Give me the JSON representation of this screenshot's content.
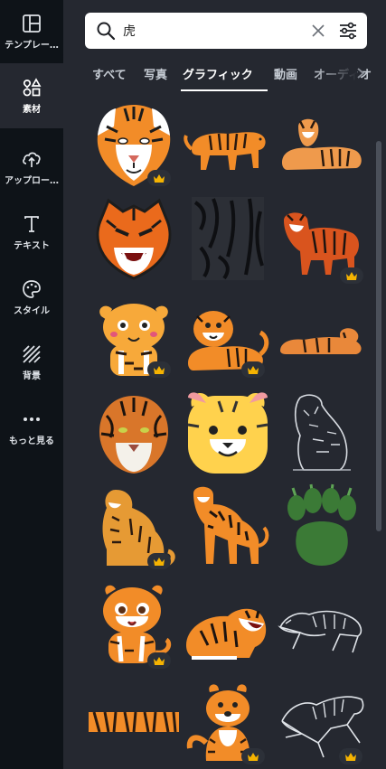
{
  "sidebar": {
    "items": [
      {
        "label": "テンプレー…",
        "icon": "template-icon"
      },
      {
        "label": "素材",
        "icon": "elements-icon"
      },
      {
        "label": "アップロー…",
        "icon": "upload-icon"
      },
      {
        "label": "テキスト",
        "icon": "text-icon"
      },
      {
        "label": "スタイル",
        "icon": "palette-icon"
      },
      {
        "label": "背景",
        "icon": "background-icon"
      },
      {
        "label": "もっと見る",
        "icon": "more-icon"
      }
    ]
  },
  "search": {
    "value": "虎",
    "placeholder": ""
  },
  "tabs": [
    {
      "label": "すべて"
    },
    {
      "label": "写真"
    },
    {
      "label": "グラフィック"
    },
    {
      "label": "動画"
    },
    {
      "label": "オーディオ"
    }
  ],
  "active_tab": "グラフィック",
  "results": [
    {
      "name": "tiger-face-illustration",
      "premium": true
    },
    {
      "name": "walking-tiger",
      "premium": false
    },
    {
      "name": "lying-tiger",
      "premium": false
    },
    {
      "name": "roaring-tiger-mascot",
      "premium": false
    },
    {
      "name": "tiger-stripes-pattern",
      "premium": false
    },
    {
      "name": "standing-tiger",
      "premium": true
    },
    {
      "name": "cartoon-tiger-cub",
      "premium": true
    },
    {
      "name": "sitting-tiger-cartoon",
      "premium": true
    },
    {
      "name": "resting-tiger",
      "premium": false
    },
    {
      "name": "realistic-tiger-head",
      "premium": false
    },
    {
      "name": "tiger-emoji-face",
      "premium": false
    },
    {
      "name": "sketch-tiger",
      "premium": false
    },
    {
      "name": "sitting-tiger",
      "premium": true
    },
    {
      "name": "prowling-tiger",
      "premium": false
    },
    {
      "name": "tiger-paw-print",
      "premium": false
    },
    {
      "name": "chibi-tiger",
      "premium": true
    },
    {
      "name": "lying-roaring-tiger",
      "premium": false
    },
    {
      "name": "line-art-tiger",
      "premium": false
    },
    {
      "name": "tiger-stripe-band",
      "premium": false
    },
    {
      "name": "cute-sitting-tiger",
      "premium": true
    },
    {
      "name": "leaping-line-tiger",
      "premium": true
    }
  ],
  "colors": {
    "sidebar_bg": "#0e1318",
    "panel_bg": "#252830",
    "accent_orange": "#f39a2a"
  }
}
